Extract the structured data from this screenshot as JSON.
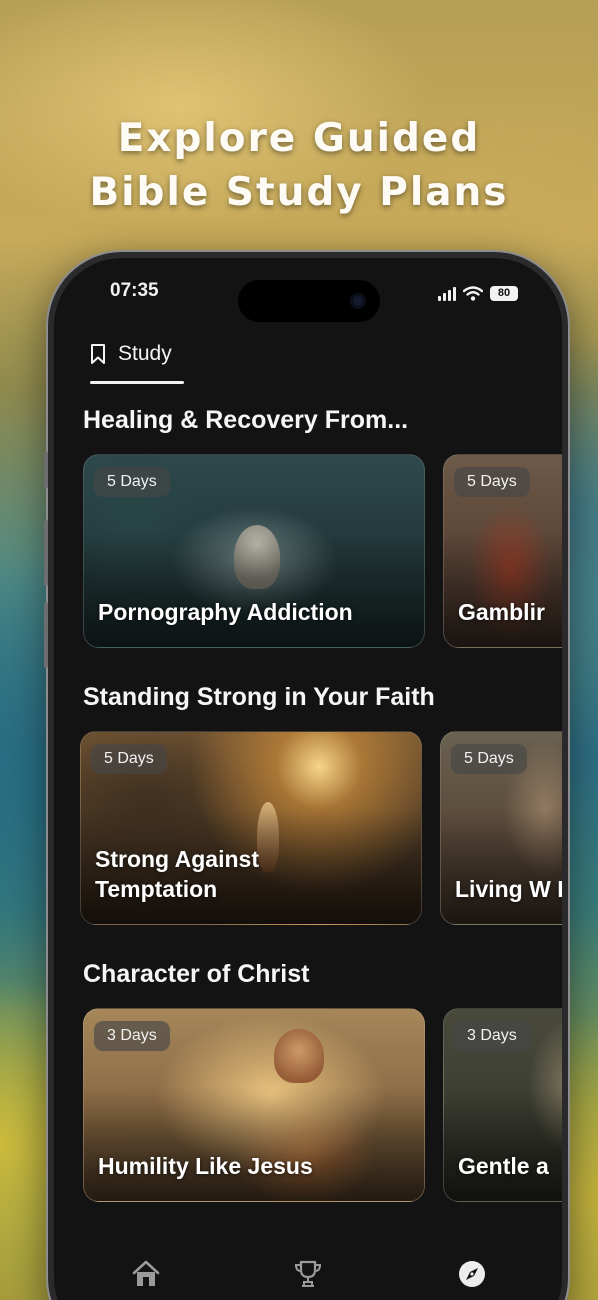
{
  "headline": {
    "line1": "Explore Guided",
    "line2": "Bible Study Plans"
  },
  "status_bar": {
    "time": "07:35",
    "battery": "80"
  },
  "tabs": [
    {
      "label": "Study",
      "icon": "bookmark-icon",
      "selected": true
    }
  ],
  "sections": [
    {
      "title": "Healing & Recovery From...",
      "cards": [
        {
          "badge": "5 Days",
          "title": "Pornography Addiction"
        },
        {
          "badge": "5 Days",
          "title": "Gamblir"
        }
      ]
    },
    {
      "title": "Standing Strong in Your Faith",
      "cards": [
        {
          "badge": "5 Days",
          "title": "Strong Against Temptation"
        },
        {
          "badge": "5 Days",
          "title": "Living W Enduring"
        }
      ]
    },
    {
      "title": "Character of Christ",
      "cards": [
        {
          "badge": "3 Days",
          "title": "Humility Like Jesus"
        },
        {
          "badge": "3 Days",
          "title": "Gentle a"
        }
      ]
    }
  ],
  "bottom_nav": [
    {
      "icon": "home-icon"
    },
    {
      "icon": "trophy-icon"
    },
    {
      "icon": "compass-icon",
      "selected": true
    }
  ]
}
